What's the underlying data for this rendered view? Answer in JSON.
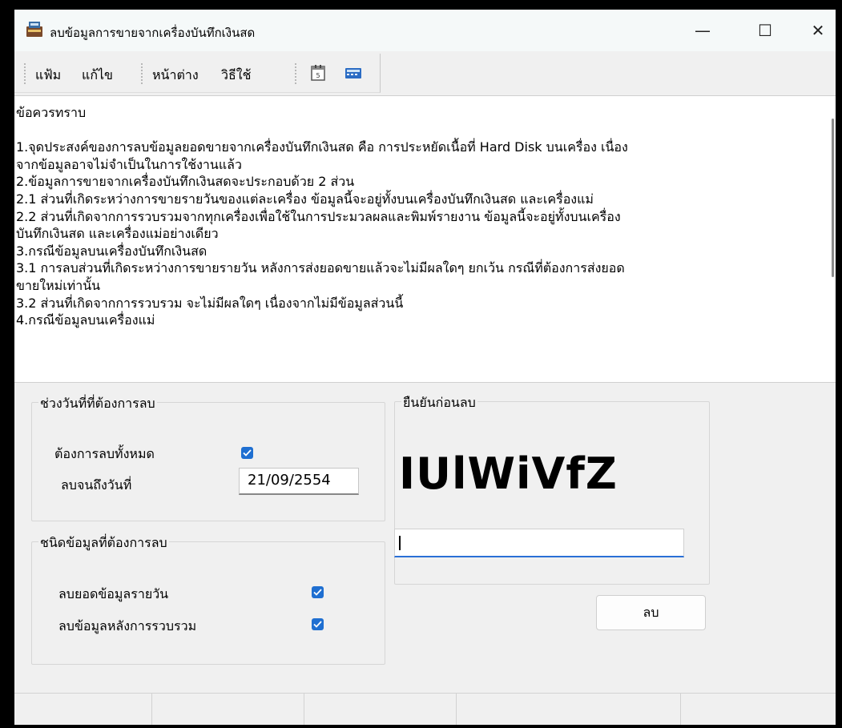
{
  "window": {
    "title": "ลบข้อมูลการขายจากเครื่องบันทึกเงินสด",
    "controls": {
      "minimize": "—",
      "maximize": "☐",
      "close": "✕"
    }
  },
  "menubar": {
    "items": [
      "แฟ้ม",
      "แก้ไข",
      "หน้าต่าง",
      "วิธีใช้"
    ],
    "tool_icons": [
      "calendar-icon",
      "calculator-icon"
    ]
  },
  "info": {
    "text": "ข้อควรทราบ\n\n1.จุดประสงค์ของการลบข้อมูลยอดขายจากเครื่องบันทึกเงินสด คือ การประหยัดเนื้อที่ Hard Disk บนเครื่อง เนื่อง\nจากข้อมูลอาจไม่จำเป็นในการใช้งานแล้ว\n2.ข้อมูลการขายจากเครื่องบันทึกเงินสดจะประกอบด้วย 2 ส่วน\n2.1 ส่วนที่เกิดระหว่างการขายรายวันของแต่ละเครื่อง ข้อมูลนี้จะอยู่ทั้งบนเครื่องบันทึกเงินสด และเครื่องแม่\n2.2 ส่วนที่เกิดจากการรวบรวมจากทุกเครื่องเพื่อใช้ในการประมวลผลและพิมพ์รายงาน ข้อมูลนี้จะอยู่ทั้งบนเครื่อง\nบันทึกเงินสด และเครื่องแม่อย่างเดียว\n3.กรณีข้อมูลบนเครื่องบันทึกเงินสด\n3.1 การลบส่วนที่เกิดระหว่างการขายรายวัน หลังการส่งยอดขายแล้วจะไม่มีผลใดๆ ยกเว้น กรณีที่ต้องการส่งยอด\nขายใหม่เท่านั้น\n3.2 ส่วนที่เกิดจากการรวบรวม จะไม่มีผลใดๆ เนื่องจากไม่มีข้อมูลส่วนนี้\n4.กรณีข้อมูลบนเครื่องแม่"
  },
  "date_range_group": {
    "legend": "ช่วงวันที่ที่ต้องการลบ",
    "delete_all_label": "ต้องการลบทั้งหมด",
    "delete_all_checked": true,
    "until_date_label": "ลบจนถึงวันที่",
    "until_date_value": "21/09/2554"
  },
  "data_type_group": {
    "legend": "ชนิดข้อมูลที่ต้องการลบ",
    "daily_label": "ลบยอดข้อมูลรายวัน",
    "daily_checked": true,
    "after_collect_label": "ลบข้อมูลหลังการรวบรวม",
    "after_collect_checked": true
  },
  "confirm_group": {
    "legend": "ยืนยันก่อนลบ",
    "captcha": "IUlWiVfZ",
    "input_value": ""
  },
  "delete_button": {
    "label": "ลบ"
  },
  "colors": {
    "accent": "#1f6fd1",
    "background": "#f0f0f0"
  }
}
